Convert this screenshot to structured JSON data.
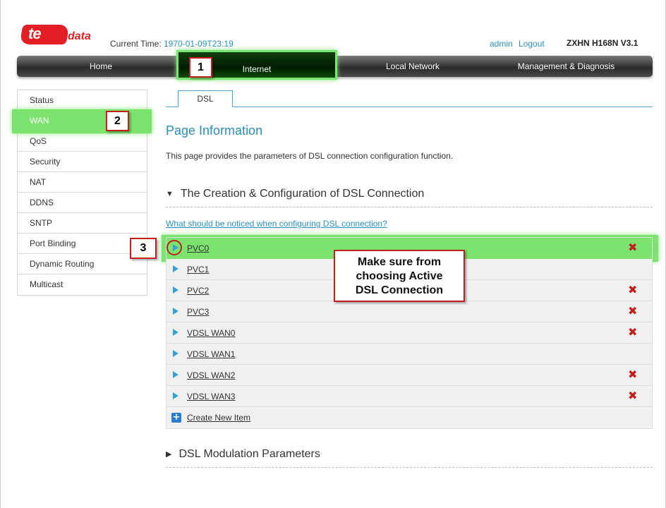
{
  "header": {
    "logo_text": "te",
    "logo_sub": "data",
    "current_time_label": "Current Time:",
    "current_time_value": "1970-01-09T23:19",
    "user": "admin",
    "logout": "Logout",
    "model": "ZXHN H168N V3.1"
  },
  "nav": {
    "home": "Home",
    "internet": "Internet",
    "local_network": "Local Network",
    "management": "Management & Diagnosis"
  },
  "sidebar": {
    "items": [
      {
        "label": "Status"
      },
      {
        "label": "WAN"
      },
      {
        "label": "QoS"
      },
      {
        "label": "Security"
      },
      {
        "label": "NAT"
      },
      {
        "label": "DDNS"
      },
      {
        "label": "SNTP"
      },
      {
        "label": "Port Binding"
      },
      {
        "label": "Dynamic Routing"
      },
      {
        "label": "Multicast"
      }
    ]
  },
  "tabs": {
    "dsl": "DSL"
  },
  "main": {
    "page_title": "Page Information",
    "page_desc": "This page provides the parameters of DSL connection configuration function.",
    "section1": "The Creation & Configuration of DSL Connection",
    "notice_link": "What should be noticed when configuring DSL connection?",
    "connections": [
      {
        "name": "PVC0",
        "deletable": true
      },
      {
        "name": "PVC1",
        "deletable": false
      },
      {
        "name": "PVC2",
        "deletable": true
      },
      {
        "name": "PVC3",
        "deletable": true
      },
      {
        "name": "VDSL WAN0",
        "deletable": true
      },
      {
        "name": "VDSL WAN1",
        "deletable": false
      },
      {
        "name": "VDSL WAN2",
        "deletable": true
      },
      {
        "name": "VDSL WAN3",
        "deletable": true
      }
    ],
    "create_new": "Create New Item",
    "section2": "DSL Modulation Parameters"
  },
  "annotations": {
    "step1": "1",
    "step2": "2",
    "step3": "3",
    "note_line1": "Make sure from",
    "note_line2": "choosing Active",
    "note_line3": "DSL Connection"
  },
  "icons": {
    "delete": "delete-x-icon",
    "expand": "expand-arrow-icon",
    "add": "plus-icon"
  },
  "colors": {
    "accent": "#2a8fb8",
    "highlight": "#7de36f",
    "callout_border": "#c0201e",
    "delete": "#c0201e"
  }
}
